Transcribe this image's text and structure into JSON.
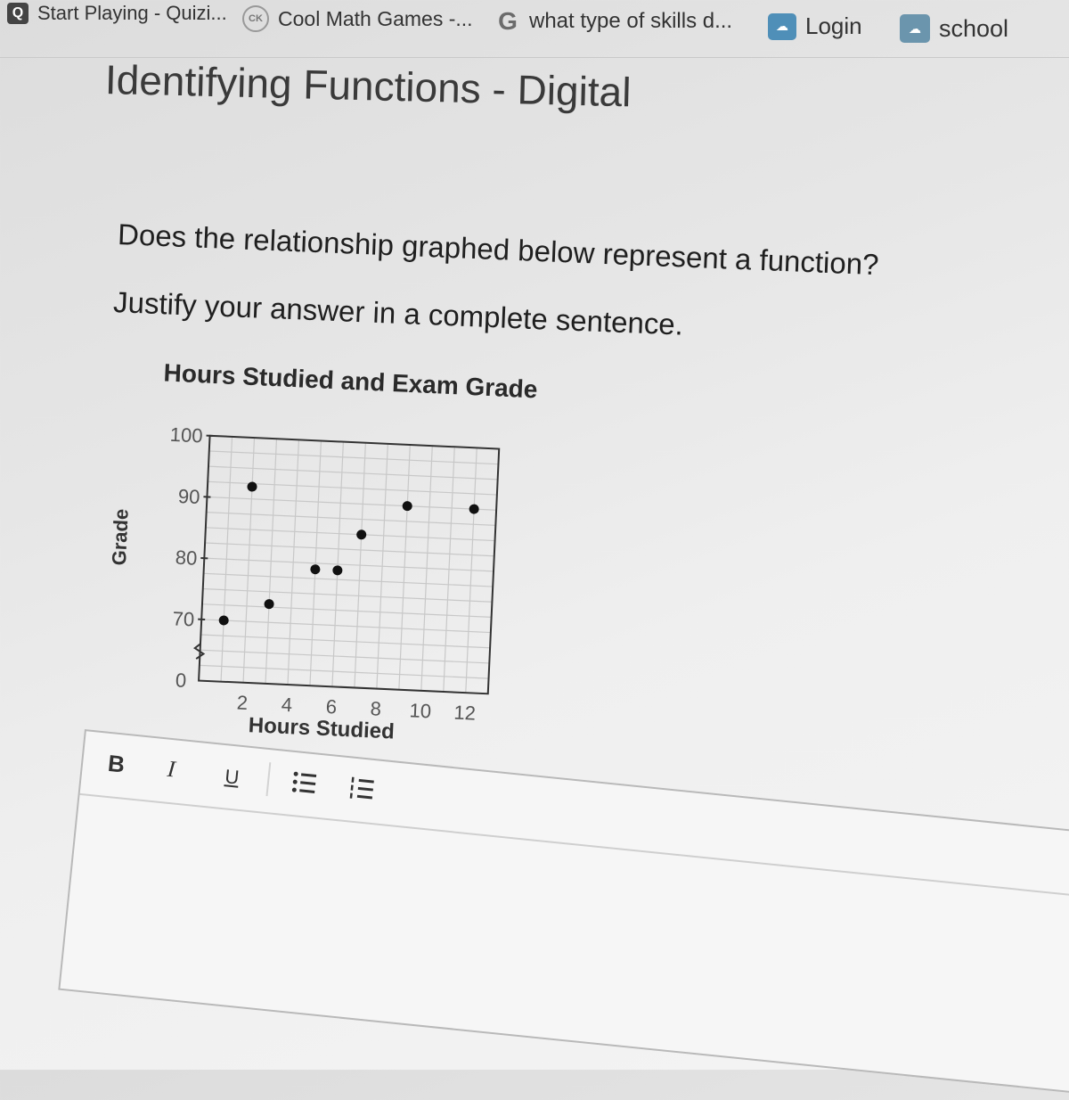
{
  "bookmarks": [
    {
      "label": "Start Playing - Quizi...",
      "icon": "quizizz-icon"
    },
    {
      "label": "Cool Math Games -...",
      "icon": "ck12-icon"
    },
    {
      "label": "what type of skills d...",
      "icon": "google-icon"
    },
    {
      "label": "Login",
      "icon": "cloud-icon"
    },
    {
      "label": "school",
      "icon": "cloud-icon"
    }
  ],
  "page": {
    "title": "Identifying Functions - Digital",
    "question": "Does the relationship graphed below represent a function?",
    "instruction": "Justify your answer in a complete sentence."
  },
  "chart_data": {
    "type": "scatter",
    "title": "Hours Studied and Exam Grade",
    "xlabel": "Hours Studied",
    "ylabel": "Grade",
    "xlim": [
      0,
      13
    ],
    "ylim": [
      0,
      100
    ],
    "axis_break": "y between 0 and 70",
    "x_ticks": [
      "2",
      "4",
      "6",
      "8",
      "10",
      "12"
    ],
    "y_ticks": [
      "100",
      "90",
      "80",
      "70"
    ],
    "origin_label": "0",
    "grid": true,
    "points": [
      {
        "x": 1,
        "y": 70
      },
      {
        "x": 2,
        "y": 92
      },
      {
        "x": 3,
        "y": 73
      },
      {
        "x": 5,
        "y": 79
      },
      {
        "x": 6,
        "y": 79
      },
      {
        "x": 7,
        "y": 85
      },
      {
        "x": 9,
        "y": 90
      },
      {
        "x": 12,
        "y": 90
      }
    ]
  },
  "editor": {
    "toolbar": {
      "bold": "B",
      "italic": "I",
      "underline": "U",
      "bulleted_list_icon": "bulleted-list-icon",
      "numbered_list_icon": "numbered-list-icon"
    },
    "value": ""
  },
  "colors": {
    "background": "#e8e8e8",
    "text": "#1f1f1f",
    "grid": "#c8c8c8",
    "point": "#111111"
  }
}
